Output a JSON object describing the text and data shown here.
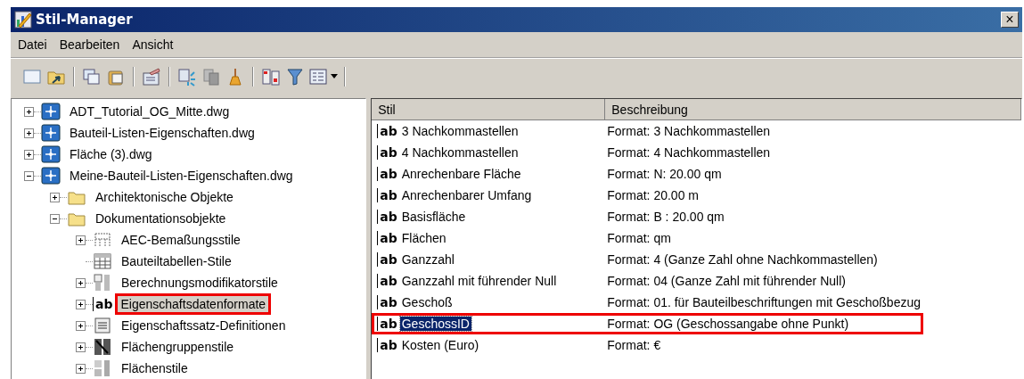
{
  "window": {
    "title": "Stil-Manager",
    "close": "×"
  },
  "menu": [
    "Datei",
    "Bearbeiten",
    "Ansicht"
  ],
  "tree": [
    {
      "label": "ADT_Tutorial_OG_Mitte.dwg",
      "kind": "drawing",
      "expanded": false,
      "selected": false,
      "highlighted": false
    },
    {
      "label": "Bauteil-Listen-Eigenschaften.dwg",
      "kind": "drawing",
      "expanded": false,
      "selected": false,
      "highlighted": false
    },
    {
      "label": "Fläche (3).dwg",
      "kind": "drawing",
      "expanded": false,
      "selected": false,
      "highlighted": false
    },
    {
      "label": "Meine-Bauteil-Listen-Eigenschaften.dwg",
      "kind": "drawing",
      "expanded": true,
      "selected": false,
      "highlighted": false,
      "children": [
        {
          "label": "Architektonische Objekte",
          "kind": "folder",
          "expanded": false,
          "selected": false,
          "highlighted": false
        },
        {
          "label": "Dokumentationsobjekte",
          "kind": "folder",
          "expanded": true,
          "selected": false,
          "highlighted": false,
          "children": [
            {
              "label": "AEC-Bemaßungsstile",
              "kind": "dimension",
              "expanded": false,
              "selected": false,
              "highlighted": false
            },
            {
              "label": "Bauteiltabellen-Stile",
              "kind": "table",
              "selected": false,
              "highlighted": false
            },
            {
              "label": "Berechnungsmodifikatorstile",
              "kind": "calc",
              "expanded": false,
              "selected": false,
              "highlighted": false
            },
            {
              "label": "Eigenschaftsdatenformate",
              "kind": "format",
              "icon_text": "ab",
              "expanded": false,
              "selected": true,
              "highlighted": true
            },
            {
              "label": "Eigenschaftssatz-Definitionen",
              "kind": "propset",
              "expanded": false,
              "selected": false,
              "highlighted": false
            },
            {
              "label": "Flächengruppenstile",
              "kind": "areagroup",
              "expanded": false,
              "selected": false,
              "highlighted": false
            },
            {
              "label": "Flächenstile",
              "kind": "area",
              "expanded": false,
              "selected": false,
              "highlighted": false
            }
          ]
        }
      ]
    }
  ],
  "table": {
    "columns": [
      "Stil",
      "Beschreibung"
    ],
    "rows": [
      {
        "icon_text": "ab",
        "style": "3 Nachkommastellen",
        "description": "Format: 3 Nachkommastellen",
        "selected": false,
        "highlighted": false
      },
      {
        "icon_text": "ab",
        "style": "4 Nachkommastellen",
        "description": "Format: 4 Nachkommastellen",
        "selected": false,
        "highlighted": false
      },
      {
        "icon_text": "ab",
        "style": "Anrechenbare Fläche",
        "description": "Format: N: 20.00 qm",
        "selected": false,
        "highlighted": false
      },
      {
        "icon_text": "ab",
        "style": "Anrechenbarer Umfang",
        "description": "Format: 20.00 m",
        "selected": false,
        "highlighted": false
      },
      {
        "icon_text": "ab",
        "style": "Basisfläche",
        "description": "Format: B : 20.00 qm",
        "selected": false,
        "highlighted": false
      },
      {
        "icon_text": "ab",
        "style": "Flächen",
        "description": "Format: qm",
        "selected": false,
        "highlighted": false
      },
      {
        "icon_text": "ab",
        "style": "Ganzzahl",
        "description": "Format: 4 (Ganze Zahl ohne Nachkommastellen)",
        "selected": false,
        "highlighted": false
      },
      {
        "icon_text": "ab",
        "style": "Ganzzahl mit führender Null",
        "description": "Format: 04 (Ganze Zahl mit führender Null)",
        "selected": false,
        "highlighted": false
      },
      {
        "icon_text": "ab",
        "style": "Geschoß",
        "description": "Format: 01. für Bauteilbeschriftungen mit Geschoßbezug",
        "selected": false,
        "highlighted": false
      },
      {
        "icon_text": "ab",
        "style": "GeschossID",
        "description": "Format: OG (Geschossangabe ohne Punkt)",
        "selected": true,
        "highlighted": true
      },
      {
        "icon_text": "ab",
        "style": "Kosten (Euro)",
        "description": "Format: €",
        "selected": false,
        "highlighted": false
      }
    ]
  }
}
